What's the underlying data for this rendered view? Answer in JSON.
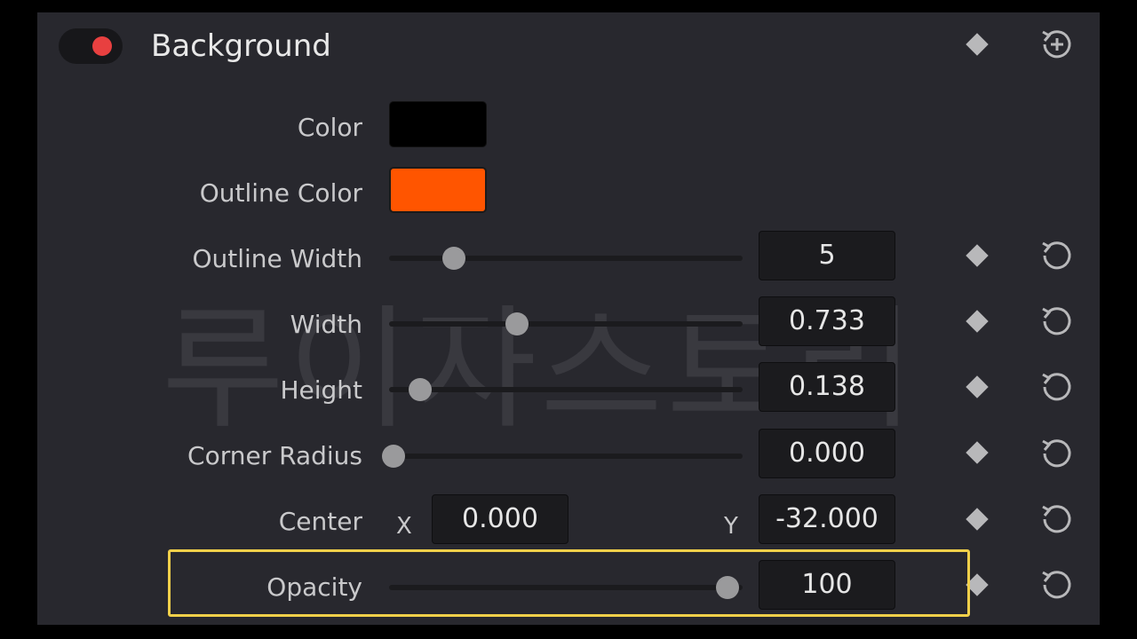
{
  "section": {
    "title": "Background",
    "enabled": true,
    "toggle_color": "#e84040"
  },
  "color": {
    "label": "Color",
    "value": "#000000"
  },
  "outline_color": {
    "label": "Outline Color",
    "value": "#ff5500"
  },
  "outline_width": {
    "label": "Outline Width",
    "value": "5",
    "slider_fraction": 0.18
  },
  "width": {
    "label": "Width",
    "value": "0.733",
    "slider_fraction": 0.37
  },
  "height": {
    "label": "Height",
    "value": "0.138",
    "slider_fraction": 0.08
  },
  "corner_radius": {
    "label": "Corner Radius",
    "value": "0.000",
    "slider_fraction": 0.0
  },
  "center": {
    "label": "Center",
    "x_label": "X",
    "x_value": "0.000",
    "y_label": "Y",
    "y_value": "-32.000"
  },
  "opacity": {
    "label": "Opacity",
    "value": "100",
    "slider_fraction": 1.0
  },
  "watermark_text": "루이자스토리",
  "icons": {
    "keyframe": "diamond-keyframe-icon",
    "reset": "reset-icon",
    "add_keyframe": "add-keyframe-icon"
  },
  "highlight_color": "#f1d04a"
}
